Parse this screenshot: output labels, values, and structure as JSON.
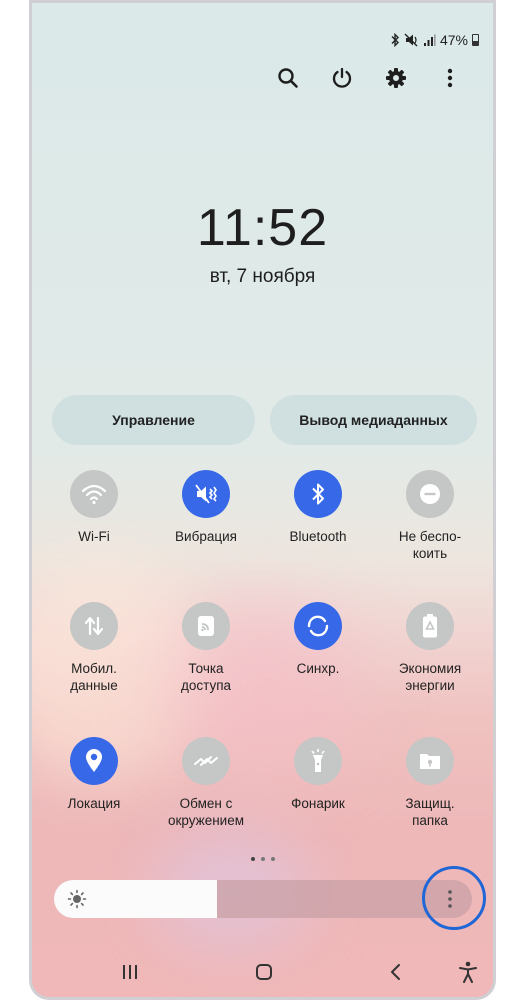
{
  "status_bar": {
    "battery_percent": "47%",
    "icons": [
      "bluetooth-icon",
      "mute-icon",
      "signal-icon",
      "battery-icon"
    ]
  },
  "top_actions": [
    "search-icon",
    "power-icon",
    "settings-icon",
    "more-options-icon"
  ],
  "clock": {
    "time": "11:52",
    "date": "вт, 7 ноября"
  },
  "pills": {
    "control": "Управление",
    "media_output": "Вывод медиаданных"
  },
  "tiles": [
    {
      "label": "Wi-Fi",
      "icon": "wifi-icon",
      "active": false
    },
    {
      "label": "Вибрация",
      "icon": "vibrate-icon",
      "active": true
    },
    {
      "label": "Bluetooth",
      "icon": "bluetooth-icon",
      "active": true
    },
    {
      "label": "Не беспо-\nкоить",
      "icon": "do-not-disturb-icon",
      "active": false
    },
    {
      "label": "Мобил.\nданные",
      "icon": "mobile-data-icon",
      "active": false
    },
    {
      "label": "Точка\nдоступа",
      "icon": "hotspot-icon",
      "active": false
    },
    {
      "label": "Синхр.",
      "icon": "sync-icon",
      "active": true
    },
    {
      "label": "Экономия\nэнергии",
      "icon": "power-saving-icon",
      "active": false
    },
    {
      "label": "Локация",
      "icon": "location-icon",
      "active": true
    },
    {
      "label": "Обмен с\nокружением",
      "icon": "nearby-share-icon",
      "active": false
    },
    {
      "label": "Фонарик",
      "icon": "flashlight-icon",
      "active": false
    },
    {
      "label": "Защищ.\nпапка",
      "icon": "secure-folder-icon",
      "active": false
    }
  ],
  "pager": {
    "pages": 3,
    "current": 1
  },
  "brightness": {
    "level": 0.39
  },
  "colors": {
    "accent": "#3668e8",
    "highlight_ring": "#1f66d6",
    "tile_off": "#c5c6c6"
  },
  "navbar": [
    "recent-apps-icon",
    "home-icon",
    "back-icon",
    "accessibility-icon"
  ]
}
